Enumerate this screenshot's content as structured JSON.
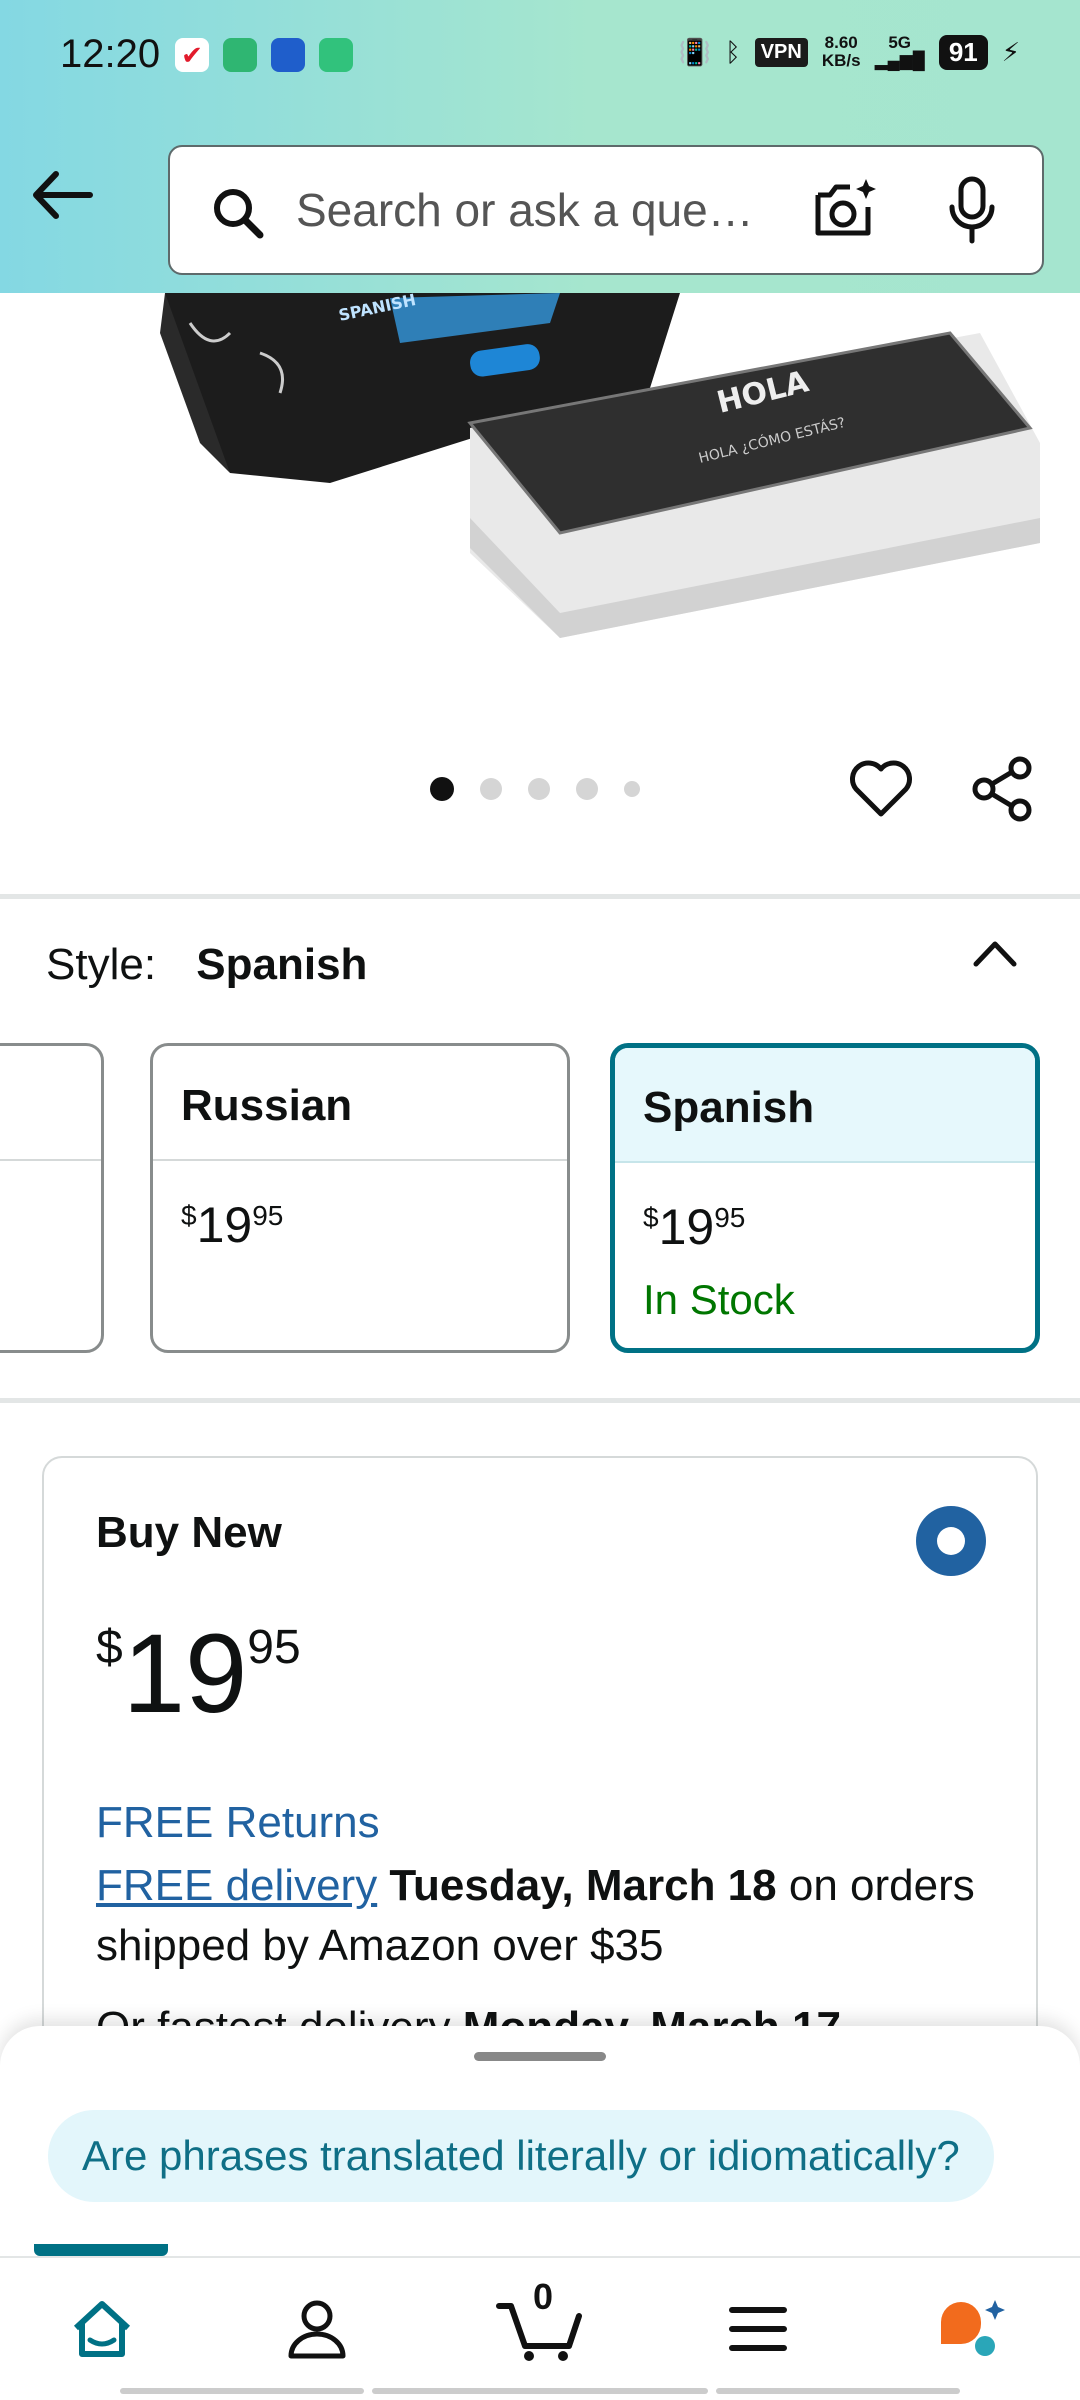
{
  "status_bar": {
    "time": "12:20",
    "vpn": "VPN",
    "net_speed_value": "8.60",
    "net_speed_unit": "KB/s",
    "network": "5G",
    "battery": "91"
  },
  "search": {
    "placeholder": "Search or ask a que…"
  },
  "style_section": {
    "label": "Style:",
    "selected": "Spanish",
    "options": [
      {
        "name": "Russian",
        "price_currency": "$",
        "price_whole": "19",
        "price_fraction": "95"
      },
      {
        "name": "Spanish",
        "price_currency": "$",
        "price_whole": "19",
        "price_fraction": "95",
        "availability": "In Stock"
      }
    ]
  },
  "buy_box": {
    "title": "Buy New",
    "price_currency": "$",
    "price_whole": "19",
    "price_fraction": "95",
    "free_returns": "FREE Returns",
    "free_delivery": "FREE delivery",
    "delivery_date": "Tuesday, March 18",
    "delivery_suffix": " on orders shipped by Amazon over $35",
    "faster_prefix": "Or fastest delivery ",
    "faster_date": "Monday, March 17"
  },
  "rufus": {
    "question": "Are phrases translated literally or idiomatically?"
  },
  "nav": {
    "cart_count": "0"
  },
  "colors": {
    "accent": "#007185",
    "link": "#2162a1",
    "in_stock": "#007600",
    "header_start": "#84d8e3",
    "header_end": "#a5e5cf"
  },
  "image_carousel": {
    "current_image": 1,
    "total_images": 5
  }
}
